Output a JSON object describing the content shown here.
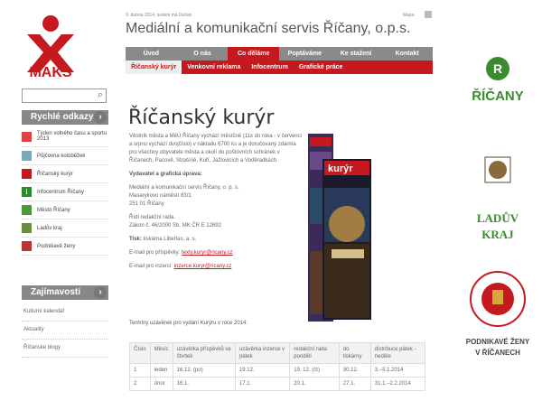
{
  "brand": {
    "name": "MAKS",
    "color": "#c41a1f"
  },
  "header": {
    "date": "9. dubna 2014, svátek má Dušan",
    "sitemap": "Mapa",
    "title": "Mediální a komunikační servis Říčany, o.p.s."
  },
  "mainnav": [
    "Úvod",
    "O nás",
    "Co děláme",
    "Poptáváme",
    "Ke stažení",
    "Kontakt"
  ],
  "mainnav_active": "Co děláme",
  "subnav": [
    "Říčanský kurýr",
    "Venkovní reklama",
    "Infocentrum",
    "Grafické práce"
  ],
  "subnav_active": "Říčanský kurýr",
  "search": {
    "placeholder": ""
  },
  "quicklinks": {
    "title": "Rychlé odkazy",
    "items": [
      {
        "label": "Týden volného času a sportu 2013",
        "icon": "sport-icon"
      },
      {
        "label": "Půjčovna koloběžek",
        "icon": "scooter-icon"
      },
      {
        "label": "Říčanský kurýr",
        "icon": "newspaper-icon"
      },
      {
        "label": "Infocentrum Říčany",
        "icon": "info-icon"
      },
      {
        "label": "Město Říčany",
        "icon": "city-icon"
      },
      {
        "label": "Ladův kraj",
        "icon": "region-icon"
      },
      {
        "label": "Podnikavé ženy",
        "icon": "women-icon"
      }
    ]
  },
  "interests": {
    "title": "Zajímavosti",
    "items": [
      "Kulturní kalendář",
      "Aktuality",
      "Říčanské blogy"
    ]
  },
  "page": {
    "title": "Říčanský kurýr",
    "intro": "Věstník města a MěÚ Říčany vychází měsíčně (11x do roka - v červenci a srpnu vychází dvojčíslo) v nákladu 6700 ks a je doručovaný zdarma pro všechny obyvatele města a okolí do poštovních schránek v Říčanech, Pacově, Strašíně, Kuří, Jažlovicích a Voděradkách.",
    "publisher_label": "Vydavatel a grafická úprava:",
    "publisher": [
      "Mediální a komunikační servis Říčany, o. p. s.",
      "Masarykovo náměstí 83/1",
      "251 01  Říčany"
    ],
    "editor": [
      "Řídí redakční rada.",
      "Zákon č. 46/2000 Sb. MK ČR E 12692"
    ],
    "print_label": "Tisk:",
    "print": "tiskárna Libertas, a. s.",
    "email1_label": "E-mail pro příspěvky:",
    "email1": "texty.kuryr@ricany.cz",
    "email2_label": "E-mail pro inzerci:",
    "email2": "inzerce.kuryr@ricany.cz",
    "deadlines": "Termíny uzávěrek pro vydání Kurýru v roce 2014:"
  },
  "magazine": {
    "masthead": "kurýr",
    "headline": "Dostavba kanalizace ve značném tempu"
  },
  "table": {
    "headers": [
      "Číslo",
      "Měsíc",
      "uzávěrka příspěvků ve čtvrtek",
      "uzávěrka inzerce v pátek",
      "redakční rada pondělí",
      "do tiskárny",
      "distribuce pátek - neděle"
    ],
    "rows": [
      [
        "1",
        "leden",
        "16.12. (po)",
        "19.12.",
        "19. 12. (čt)",
        "30.12.",
        "3.–5.1.2014"
      ],
      [
        "2",
        "únor",
        "16.1.",
        "17.1.",
        "20.1.",
        "27.1.",
        "31.1.–2.2.2014"
      ]
    ]
  },
  "right_logos": [
    {
      "label": "ŘÍČANY",
      "color": "#3a8a2e"
    },
    {
      "label": "LADŮV KRAJ",
      "color": "#3a8a2e"
    },
    {
      "label": "PODNIKAVÉ ŽENY V ŘÍČANECH",
      "color": "#c41a1f"
    }
  ]
}
